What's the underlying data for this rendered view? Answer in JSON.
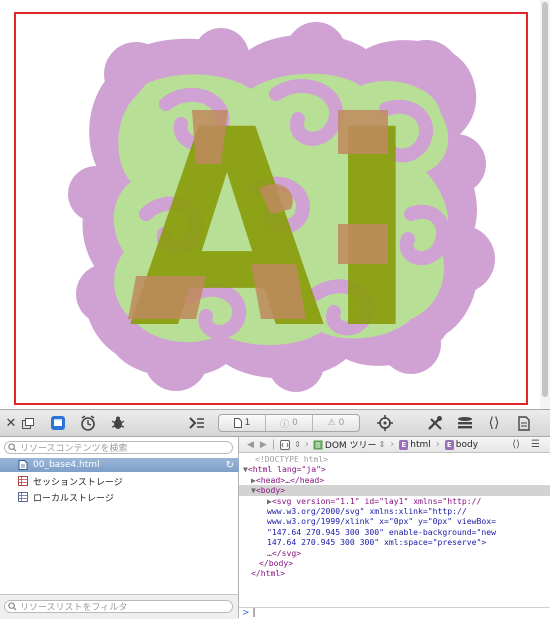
{
  "page": {
    "artwork_text": "AI",
    "colors": {
      "frame_border": "#e0262a",
      "lilac": "#cfa2d3",
      "green": "#b8df96",
      "letters": "#8a9c0c",
      "letters_overlap": "#c08a5e"
    }
  },
  "toolbar": {
    "icons": [
      "close-icon",
      "dock-icon",
      "resources-icon",
      "timeline-icon",
      "debugger-icon",
      "console-prompt-icon",
      "inspect-icon",
      "tools-icon",
      "layers-icon",
      "source-icon",
      "document-icon"
    ],
    "counter_docs": "1",
    "counter_errors": "0",
    "counter_warnings": "0"
  },
  "sidebar": {
    "search_placeholder": "リソースコンテンツを検索",
    "items": [
      {
        "label": "00_base4.html",
        "icon": "html-document-icon"
      },
      {
        "label": "セッションストレージ",
        "icon": "session-storage-icon"
      },
      {
        "label": "ローカルストレージ",
        "icon": "local-storage-icon"
      }
    ],
    "filter_placeholder": "リソースリストをフィルタ"
  },
  "breadcrumb": {
    "root_label": "DOM ツリー",
    "html_label": "html",
    "body_label": "body"
  },
  "dom": {
    "lines": [
      "<!DOCTYPE html>",
      "<html lang=\"ja\">",
      "<head>…</head>",
      "<body>",
      "<svg version=\"1.1\" id=\"lay1\" xmlns=\"http://",
      "www.w3.org/2000/svg\" xmlns:xlink=\"http://",
      "www.w3.org/1999/xlink\" x=\"0px\" y=\"0px\" viewBox=",
      "\"147.64 270.945 300 300\" enable-background=\"new",
      "147.64 270.945 300 300\" xml:space=\"preserve\">",
      "…</svg>",
      "</body>",
      "</html>"
    ],
    "console_prompt": ">"
  }
}
